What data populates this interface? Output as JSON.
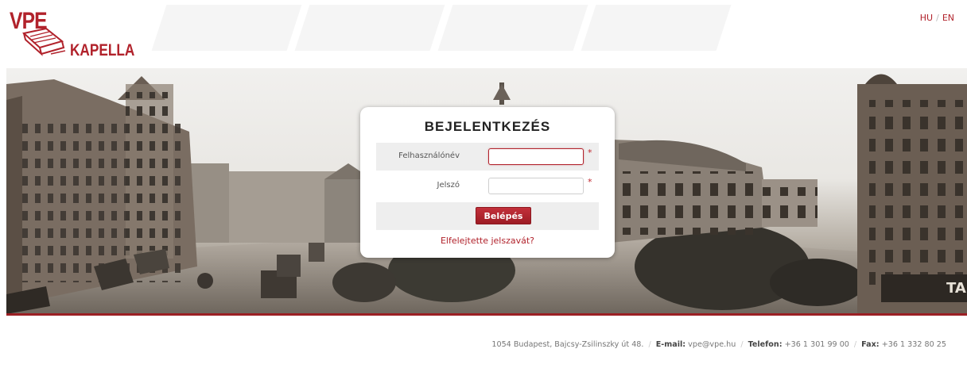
{
  "brand": {
    "line1": "VPE",
    "line2": "KAPELLA",
    "accent_color": "#b1222b",
    "icon": "book-pen-logo-icon"
  },
  "language": {
    "hu": "HU",
    "separator": "/",
    "en": "EN"
  },
  "banner": {
    "image": "vintage-budapest-street-photo",
    "sign_text": "TA",
    "bottom_line_color": "#9b1f24"
  },
  "login": {
    "title": "BEJELENTKEZÉS",
    "username_label": "Felhasználónév",
    "username_value": "",
    "password_label": "Jelszó",
    "password_value": "",
    "required_mark": "*",
    "submit_label": "Belépés",
    "forgot_link": "Elfelejtette jelszavát?"
  },
  "footer": {
    "address": "1054 Budapest, Bajcsy-Zsilinszky út 48.",
    "separator": "/",
    "email_label": "E-mail:",
    "email_value": "vpe@vpe.hu",
    "phone_label": "Telefon:",
    "phone_value": "+36 1 301 99 00",
    "fax_label": "Fax:",
    "fax_value": "+36 1 332 80 25"
  }
}
